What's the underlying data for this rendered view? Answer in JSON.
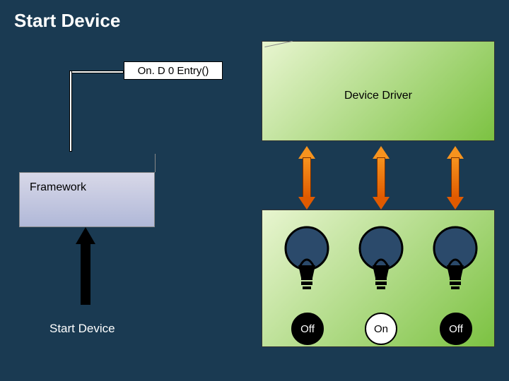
{
  "title": "Start Device",
  "callback_label": "On. D 0 Entry()",
  "driver_label": "Device Driver",
  "framework_label": "Framework",
  "start_label": "Start Device",
  "bulbs": [
    {
      "state": "Off",
      "style": "off"
    },
    {
      "state": "On",
      "style": "on"
    },
    {
      "state": "Off",
      "style": "off"
    }
  ]
}
